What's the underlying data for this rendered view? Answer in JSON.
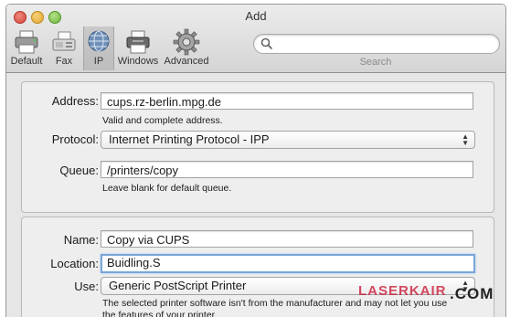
{
  "window": {
    "title": "Add"
  },
  "toolbar": {
    "items": [
      {
        "label": "Default",
        "icon": "default-printer-icon"
      },
      {
        "label": "Fax",
        "icon": "fax-icon"
      },
      {
        "label": "IP",
        "icon": "globe-icon",
        "selected": true
      },
      {
        "label": "Windows",
        "icon": "windows-printer-icon"
      },
      {
        "label": "Advanced",
        "icon": "gear-icon"
      }
    ],
    "search_label": "Search",
    "search_value": ""
  },
  "connection": {
    "address_label": "Address:",
    "address_value": "cups.rz-berlin.mpg.de",
    "address_hint": "Valid and complete address.",
    "protocol_label": "Protocol:",
    "protocol_value": "Internet Printing Protocol - IPP",
    "queue_label": "Queue:",
    "queue_value": "/printers/copy",
    "queue_hint": "Leave blank for default queue."
  },
  "printer": {
    "name_label": "Name:",
    "name_value": "Copy via CUPS",
    "location_label": "Location:",
    "location_value": "Buidling.S",
    "use_label": "Use:",
    "use_value": "Generic PostScript Printer",
    "use_hint_line1": "The selected printer software isn't from the manufacturer and may not let you use",
    "use_hint_line2": "the features of your printer."
  },
  "watermark": {
    "text": "LASERKAIR",
    "suffix": ".COM"
  },
  "colors": {
    "focus_ring": "#78a6d8",
    "close": "#d2443a",
    "minimize": "#e0a52a",
    "zoom": "#6cb43a"
  }
}
